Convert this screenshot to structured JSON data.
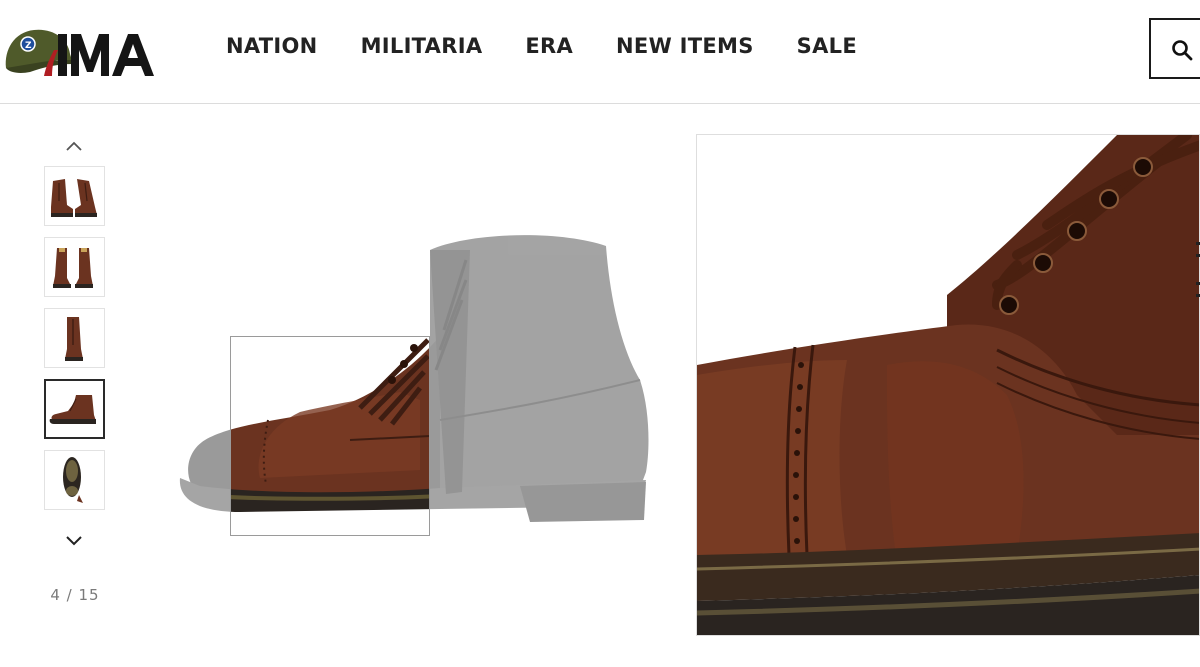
{
  "brand": {
    "logo_text": "IMA",
    "logo_icon": "helmet-icon",
    "colors": {
      "red": "#b01d22",
      "dark": "#151515",
      "helmet": "#4f5a2a",
      "badge": "#1f4e9c"
    }
  },
  "nav": {
    "items": [
      {
        "label": "NATION"
      },
      {
        "label": "MILITARIA"
      },
      {
        "label": "ERA"
      },
      {
        "label": "NEW ITEMS"
      },
      {
        "label": "SALE"
      }
    ],
    "search_icon": "search-icon"
  },
  "gallery": {
    "up_icon": "chevron-up-icon",
    "down_icon": "chevron-down-icon",
    "thumbnails": [
      {
        "view": "pair-front",
        "active": false
      },
      {
        "view": "pair-back",
        "active": false
      },
      {
        "view": "single-front",
        "active": false
      },
      {
        "view": "side-profile",
        "active": true
      },
      {
        "view": "sole",
        "active": false
      }
    ],
    "counter": "4 / 15",
    "current_index": 4,
    "total": 15
  },
  "colors": {
    "leather": "#6b3320",
    "leather_dark": "#3e1d12",
    "sole": "#2a2420",
    "faded": "#8e8e8e"
  }
}
